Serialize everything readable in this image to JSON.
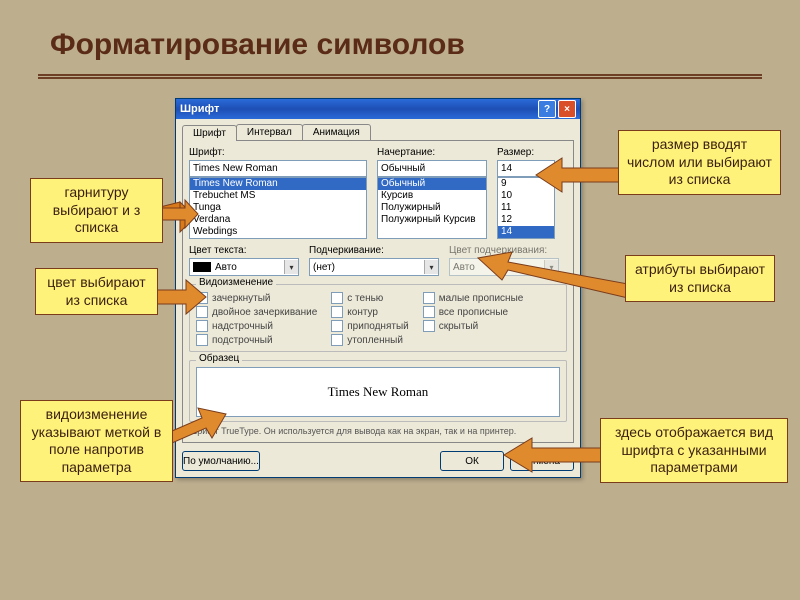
{
  "title": "Форматирование символов",
  "annotations": {
    "garnitura": "гарнитуру выбирают и з списка",
    "color": "цвет выбирают из списка",
    "vidoizm": "видоизменение указывают меткой в поле напротив параметра",
    "size": "размер вводят числом или выбирают из списка",
    "attrib": "атрибуты выбирают из списка",
    "preview": "здесь отображается вид шрифта с указанными параметрами"
  },
  "dialog": {
    "title": "Шрифт",
    "tabs": [
      "Шрифт",
      "Интервал",
      "Анимация"
    ],
    "font_label": "Шрифт:",
    "font_value": "Times New Roman",
    "font_list": [
      "Times New Roman",
      "Trebuchet MS",
      "Tunga",
      "Verdana",
      "Webdings"
    ],
    "style_label": "Начертание:",
    "style_value": "Обычный",
    "style_list": [
      "Обычный",
      "Курсив",
      "Полужирный",
      "Полужирный Курсив"
    ],
    "size_label": "Размер:",
    "size_value": "14",
    "size_list": [
      "9",
      "10",
      "11",
      "12",
      "14"
    ],
    "color_label": "Цвет текста:",
    "color_value": "Авто",
    "underline_label": "Подчеркивание:",
    "underline_value": "(нет)",
    "ucolor_label": "Цвет подчеркивания:",
    "ucolor_value": "Авто",
    "group_vid": "Видоизменение",
    "checks_col1": [
      "зачеркнутый",
      "двойное зачеркивание",
      "надстрочный",
      "подстрочный"
    ],
    "checks_col2": [
      "с тенью",
      "контур",
      "приподнятый",
      "утопленный"
    ],
    "checks_col3": [
      "малые прописные",
      "все прописные",
      "скрытый"
    ],
    "group_sample": "Образец",
    "sample_text": "Times New Roman",
    "hint": "Шрифт TrueType. Он используется для вывода как на экран, так и на принтер.",
    "btn_default": "По умолчанию...",
    "btn_ok": "ОК",
    "btn_cancel": "Отмена"
  }
}
